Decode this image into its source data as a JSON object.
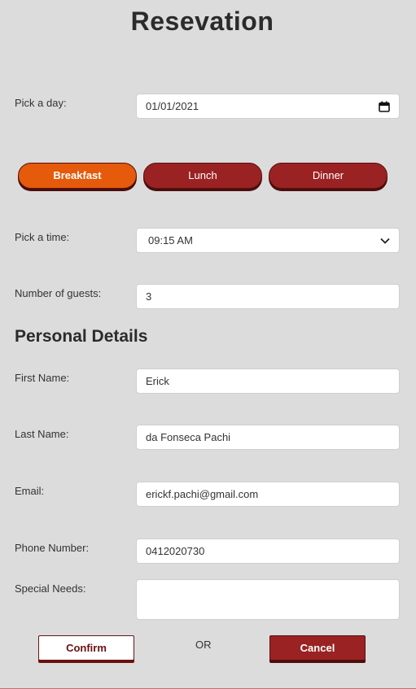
{
  "page": {
    "title": "Resevation"
  },
  "day": {
    "label": "Pick a day:",
    "value": "01/01/2021",
    "icon": "calendar-icon"
  },
  "meals": [
    {
      "label": "Breakfast",
      "active": true
    },
    {
      "label": "Lunch",
      "active": false
    },
    {
      "label": "Dinner",
      "active": false
    }
  ],
  "time": {
    "label": "Pick a time:",
    "value": "09:15 AM",
    "icon": "chevron-down-icon"
  },
  "guests": {
    "label": "Number of guests:",
    "value": "3"
  },
  "personal": {
    "heading": "Personal Details",
    "first_name": {
      "label": "First Name:",
      "value": "Erick"
    },
    "last_name": {
      "label": "Last Name:",
      "value": "da Fonseca Pachi"
    },
    "email": {
      "label": "Email:",
      "value": "erickf.pachi@gmail.com"
    },
    "phone": {
      "label": "Phone Number:",
      "value": "0412020730"
    },
    "special_needs": {
      "label": "Special Needs:",
      "value": ""
    }
  },
  "actions": {
    "confirm": "Confirm",
    "or": "OR",
    "cancel": "Cancel"
  },
  "colors": {
    "background": "#dcdcdc",
    "meal_active": "#e55a0b",
    "meal_inactive": "#9b2222",
    "cancel": "#9b2222",
    "confirm_border": "#6b1010"
  }
}
